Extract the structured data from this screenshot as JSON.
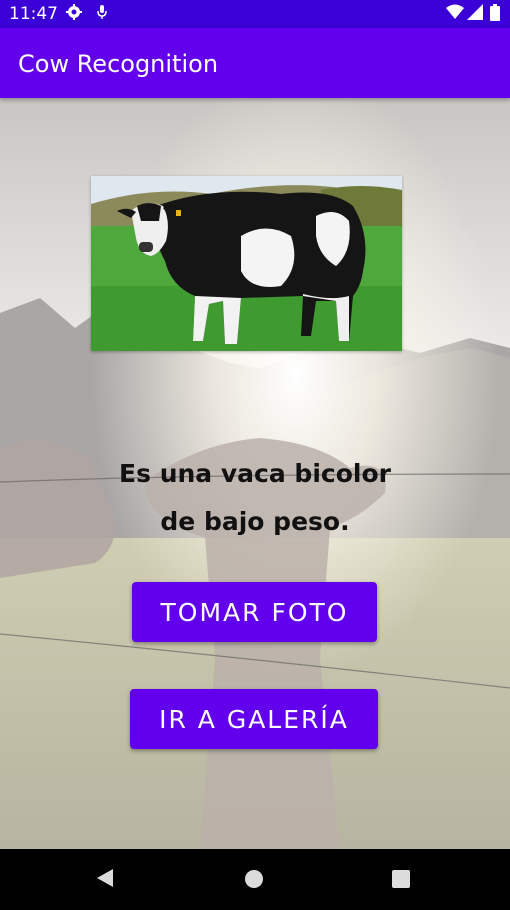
{
  "status_bar": {
    "time": "11:47",
    "icons": [
      "settings-icon",
      "microphone-icon",
      "wifi-icon",
      "signal-icon",
      "battery-icon"
    ]
  },
  "app_bar": {
    "title": "Cow Recognition",
    "color": "#6200ee"
  },
  "main": {
    "result_line_1": "Es una vaca bicolor",
    "result_line_2": "de bajo peso.",
    "take_photo_label": "TOMAR FOTO",
    "gallery_label": "IR A GALERÍA"
  },
  "nav_bar": {
    "icons": [
      "back-icon",
      "home-icon",
      "recents-icon"
    ]
  }
}
